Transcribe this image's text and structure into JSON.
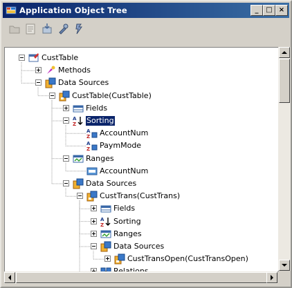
{
  "window": {
    "title": "Application Object Tree",
    "controls": [
      "_",
      "□",
      "×"
    ]
  },
  "toolbar": {
    "buttons": [
      "open-icon",
      "properties-icon",
      "import-icon",
      "tools-icon",
      "compile-icon"
    ]
  },
  "tree": {
    "nodes": [
      {
        "label": "CustTable",
        "expander": "minus",
        "icon": "table-icon"
      },
      {
        "label": "Methods",
        "expander": "plus",
        "icon": "methods-icon"
      },
      {
        "label": "Data Sources",
        "expander": "minus",
        "icon": "datasources-icon"
      },
      {
        "label": "CustTable(CustTable)",
        "expander": "minus",
        "icon": "datasource-icon"
      },
      {
        "label": "Fields",
        "expander": "plus",
        "icon": "fields-icon"
      },
      {
        "label": "Sorting",
        "expander": "minus",
        "icon": "sorting-icon",
        "selected": true
      },
      {
        "label": "AccountNum",
        "expander": "none",
        "icon": "sort-field-icon"
      },
      {
        "label": "PaymMode",
        "expander": "none",
        "icon": "sort-field-icon"
      },
      {
        "label": "Ranges",
        "expander": "minus",
        "icon": "ranges-icon"
      },
      {
        "label": "AccountNum",
        "expander": "none",
        "icon": "range-field-icon"
      },
      {
        "label": "Data Sources",
        "expander": "minus",
        "icon": "datasources-icon"
      },
      {
        "label": "CustTrans(CustTrans)",
        "expander": "minus",
        "icon": "datasource-icon"
      },
      {
        "label": "Fields",
        "expander": "plus",
        "icon": "fields-icon"
      },
      {
        "label": "Sorting",
        "expander": "plus",
        "icon": "sorting-icon"
      },
      {
        "label": "Ranges",
        "expander": "plus",
        "icon": "ranges-icon"
      },
      {
        "label": "Data Sources",
        "expander": "minus",
        "icon": "datasources-icon"
      },
      {
        "label": "CustTransOpen(CustTransOpen)",
        "expander": "plus",
        "icon": "datasource-icon"
      },
      {
        "label": "Relations",
        "expander": "plus",
        "icon": "relations-icon"
      }
    ]
  },
  "colors": {
    "titlebar_start": "#0a246a",
    "titlebar_end": "#3a6ea5",
    "selection": "#0a246a"
  }
}
